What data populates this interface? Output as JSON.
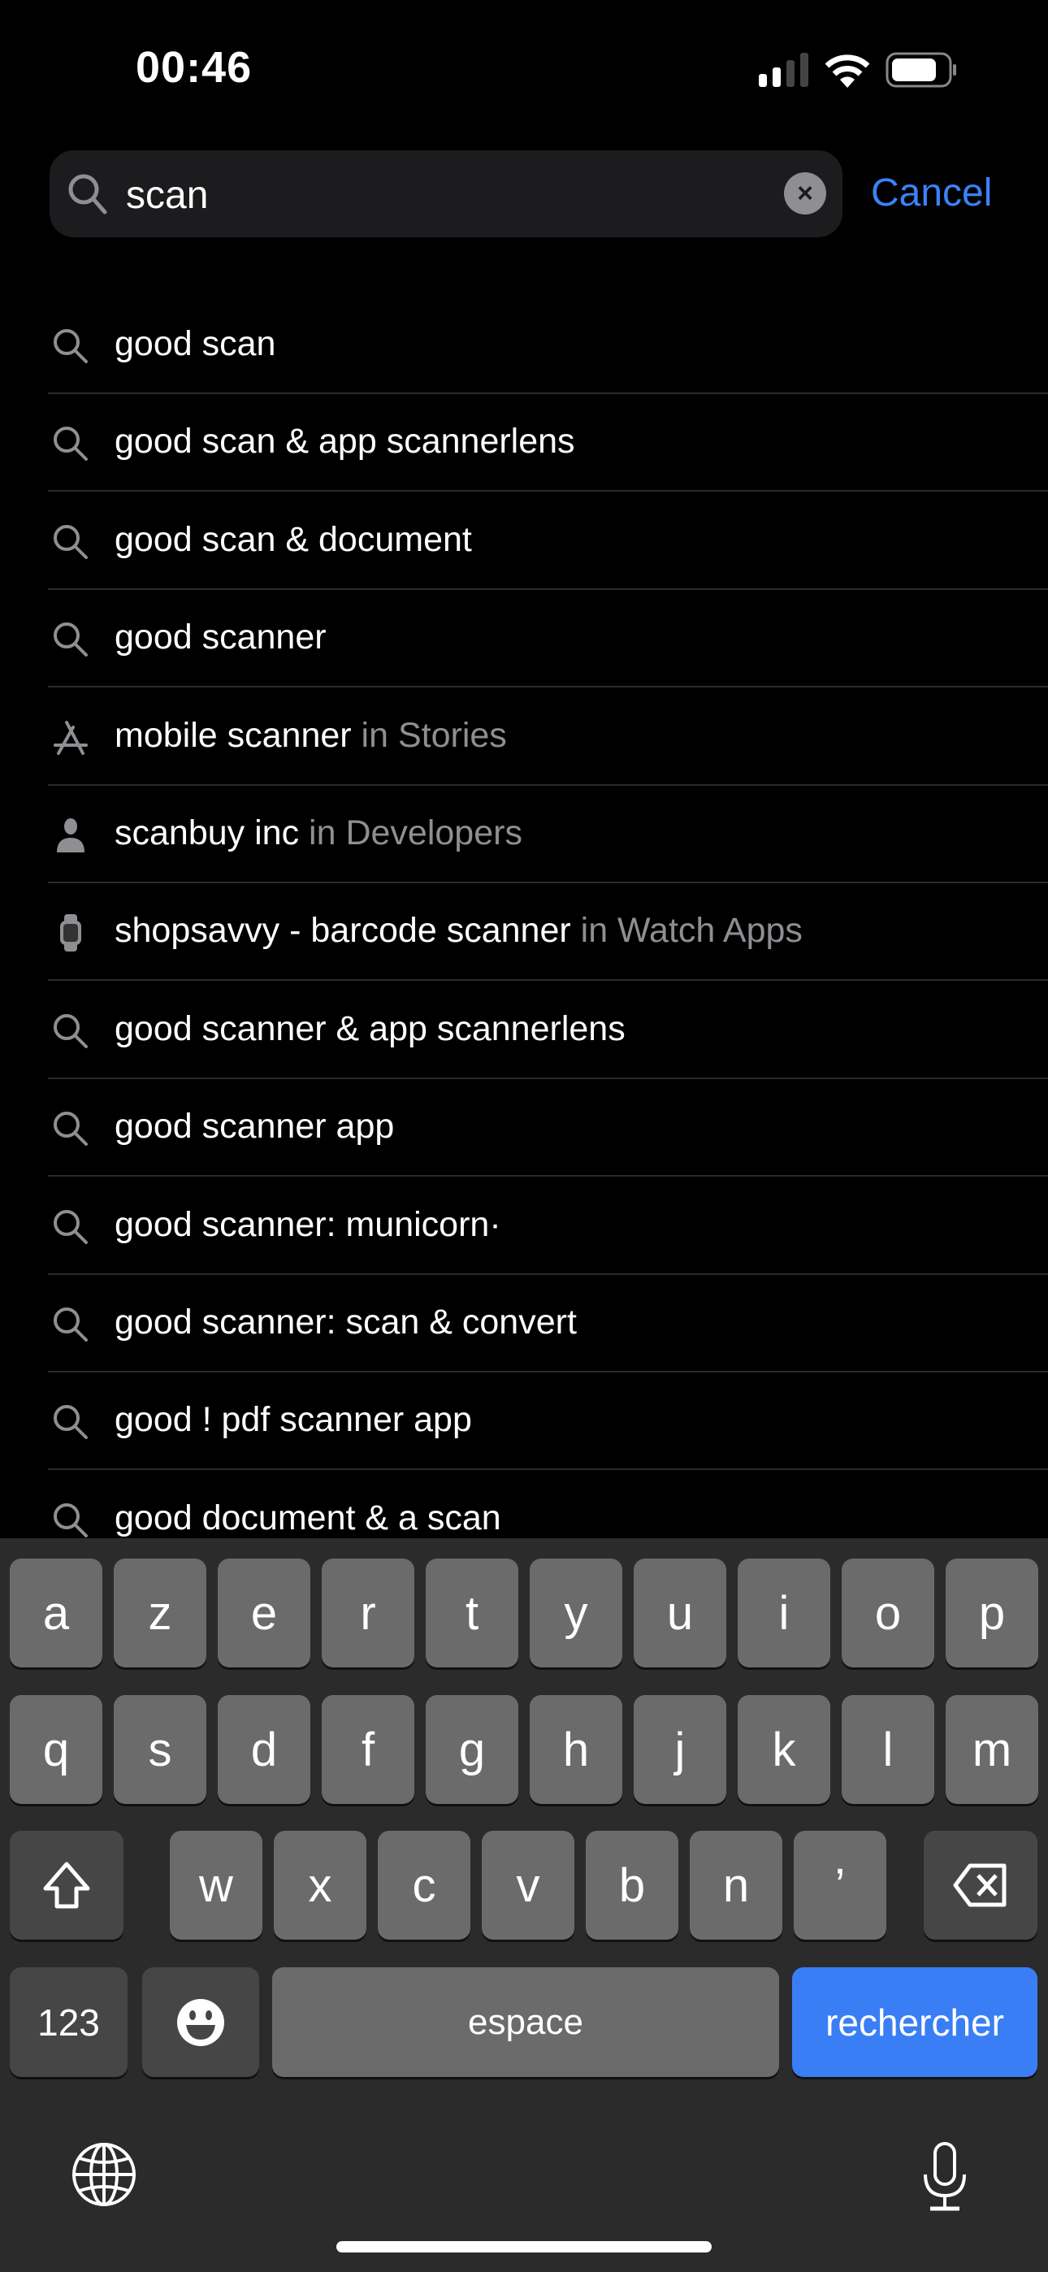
{
  "status_bar": {
    "time": "00:46",
    "signal_bars": 2,
    "battery_level": 0.8
  },
  "search": {
    "query": "scan",
    "cancel_label": "Cancel",
    "accent_color": "#3a82f7"
  },
  "suggestions": [
    {
      "icon": "search-icon",
      "text": "good scan",
      "scope": ""
    },
    {
      "icon": "search-icon",
      "text": "good scan & app scannerlens",
      "scope": ""
    },
    {
      "icon": "search-icon",
      "text": "good scan & document",
      "scope": ""
    },
    {
      "icon": "search-icon",
      "text": "good scanner",
      "scope": ""
    },
    {
      "icon": "app-store-icon",
      "text": "mobile scanner",
      "scope": "in Stories"
    },
    {
      "icon": "person-icon",
      "text": "scanbuy inc",
      "scope": "in Developers"
    },
    {
      "icon": "watch-icon",
      "text": "shopsavvy - barcode scanner",
      "scope": "in Watch Apps"
    },
    {
      "icon": "search-icon",
      "text": "good scanner & app scannerlens",
      "scope": ""
    },
    {
      "icon": "search-icon",
      "text": "good scanner app",
      "scope": ""
    },
    {
      "icon": "search-icon",
      "text": "good scanner: municorn·",
      "scope": ""
    },
    {
      "icon": "search-icon",
      "text": "good scanner: scan & convert",
      "scope": ""
    },
    {
      "icon": "search-icon",
      "text": "good ! pdf scanner app",
      "scope": ""
    },
    {
      "icon": "search-icon",
      "text": "good document & a scan",
      "scope": ""
    }
  ],
  "keyboard": {
    "row1": [
      "a",
      "z",
      "e",
      "r",
      "t",
      "y",
      "u",
      "i",
      "o",
      "p"
    ],
    "row2": [
      "q",
      "s",
      "d",
      "f",
      "g",
      "h",
      "j",
      "k",
      "l",
      "m"
    ],
    "row3": [
      "w",
      "x",
      "c",
      "v",
      "b",
      "n",
      "’"
    ],
    "numbers_label": "123",
    "space_label": "espace",
    "search_label": "rechercher",
    "search_color": "#3a7ef5"
  }
}
